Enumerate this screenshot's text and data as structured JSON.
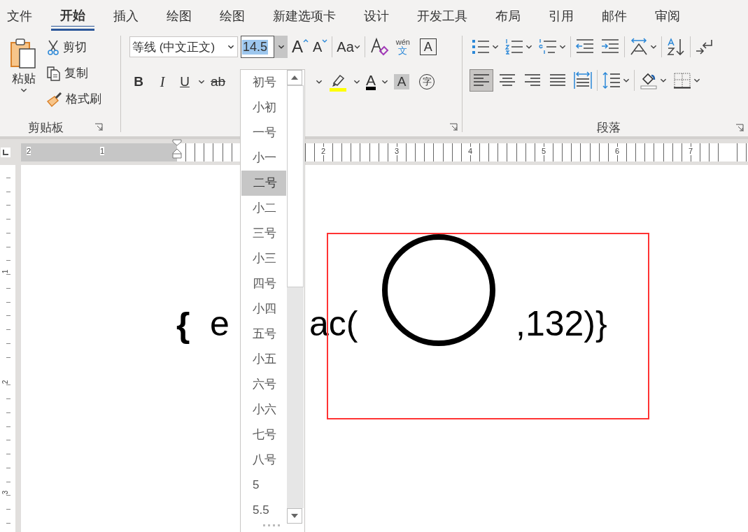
{
  "tabs": [
    {
      "label": "文件",
      "selected": false
    },
    {
      "label": "开始",
      "selected": true
    },
    {
      "label": "插入",
      "selected": false
    },
    {
      "label": "绘图",
      "selected": false
    },
    {
      "label": "绘图",
      "selected": false
    },
    {
      "label": "新建选项卡",
      "selected": false
    },
    {
      "label": "设计",
      "selected": false
    },
    {
      "label": "开发工具",
      "selected": false
    },
    {
      "label": "布局",
      "selected": false
    },
    {
      "label": "引用",
      "selected": false
    },
    {
      "label": "邮件",
      "selected": false
    },
    {
      "label": "审阅",
      "selected": false
    }
  ],
  "clipboard": {
    "paste": "粘贴",
    "cut": "剪切",
    "copy": "复制",
    "format_painter": "格式刷",
    "group_label": "剪贴板"
  },
  "font": {
    "font_name": "等线 (中文正文)",
    "font_size": "14.5",
    "grow": "A",
    "shrink": "A",
    "change_case": "Aa",
    "bold": "B",
    "italic": "I",
    "underline": "U",
    "strikethrough": "ab",
    "font_color": "A",
    "char_shading": "A",
    "enclose": "字",
    "phonetic_top": "wén",
    "phonetic_bottom": "文",
    "char_border": "A"
  },
  "paragraph": {
    "group_label": "段落",
    "row1": [
      {
        "kind": "bullets",
        "dropdown": true
      },
      {
        "kind": "numbering",
        "dropdown": true
      },
      {
        "kind": "multilevel",
        "dropdown": true
      },
      {
        "kind": "outdent",
        "dropdown": false
      },
      {
        "kind": "indent",
        "dropdown": false
      },
      {
        "kind": "direction",
        "dropdown": true
      },
      {
        "kind": "sort",
        "dropdown": false
      },
      {
        "kind": "marks",
        "dropdown": false
      }
    ],
    "row2": [
      {
        "kind": "align-left",
        "dropdown": false,
        "selected": true
      },
      {
        "kind": "align-center",
        "dropdown": false,
        "selected": false
      },
      {
        "kind": "align-right",
        "dropdown": false,
        "selected": false
      },
      {
        "kind": "justify",
        "dropdown": false,
        "selected": false
      },
      {
        "kind": "distribute",
        "dropdown": false,
        "selected": false
      },
      {
        "kind": "spacing",
        "dropdown": true,
        "selected": false
      },
      {
        "kind": "shading",
        "dropdown": true,
        "selected": false
      },
      {
        "kind": "borders",
        "dropdown": true,
        "selected": false
      }
    ]
  },
  "ruler": {
    "left_numbers": [
      "2",
      "1"
    ],
    "right_numbers": [
      "2",
      "3",
      "4",
      "5",
      "6",
      "7"
    ],
    "vertical_numbers": [
      "1",
      "2",
      "3"
    ]
  },
  "document": {
    "brace_open": "{",
    "text_left": "e",
    "text_middle": "ac(",
    "text_right": ",132)}"
  },
  "size_dropdown": {
    "items": [
      {
        "label": "初号",
        "selected": false
      },
      {
        "label": "小初",
        "selected": false
      },
      {
        "label": "一号",
        "selected": false
      },
      {
        "label": "小一",
        "selected": false
      },
      {
        "label": "二号",
        "selected": true
      },
      {
        "label": "小二",
        "selected": false
      },
      {
        "label": "三号",
        "selected": false
      },
      {
        "label": "小三",
        "selected": false
      },
      {
        "label": "四号",
        "selected": false
      },
      {
        "label": "小四",
        "selected": false
      },
      {
        "label": "五号",
        "selected": false
      },
      {
        "label": "小五",
        "selected": false
      },
      {
        "label": "六号",
        "selected": false
      },
      {
        "label": "小六",
        "selected": false
      },
      {
        "label": "七号",
        "selected": false
      },
      {
        "label": "八号",
        "selected": false
      },
      {
        "label": "5",
        "selected": false
      },
      {
        "label": "5.5",
        "selected": false
      }
    ]
  }
}
